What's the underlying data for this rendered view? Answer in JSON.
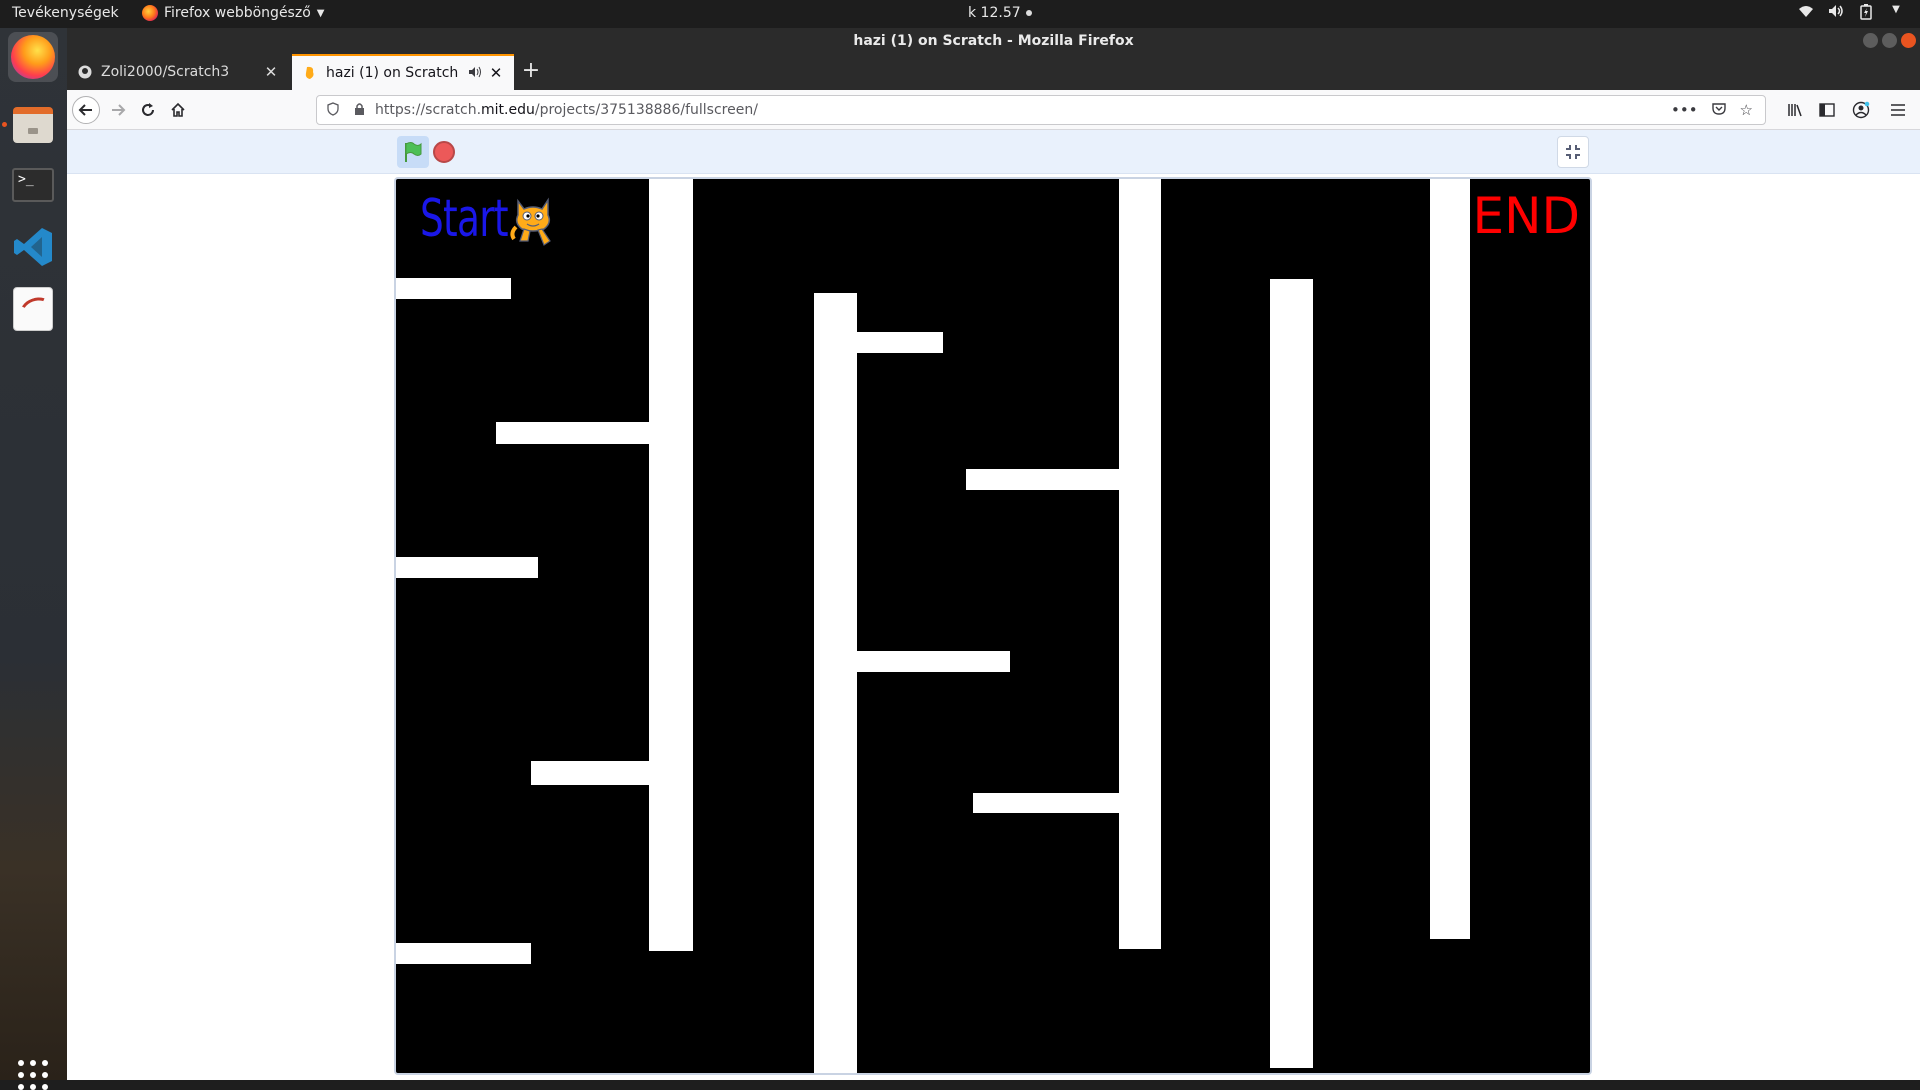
{
  "topbar": {
    "activities": "Tevékenységek",
    "app_menu": "Firefox webböngésző",
    "clock": "k 12.57"
  },
  "window": {
    "title": "hazi (1) on Scratch - Mozilla Firefox"
  },
  "tabs": [
    {
      "title": "Zoli2000/Scratch3",
      "icon": "github-icon"
    },
    {
      "title": "hazi (1) on Scratch",
      "icon": "scratch-icon",
      "active": true,
      "playing_audio": true
    }
  ],
  "navbar": {
    "url_prefix": "https://scratch.",
    "url_domain": "mit.edu",
    "url_path": "/projects/375138886/fullscreen/"
  },
  "stage": {
    "start_label": "Start",
    "end_label": "END",
    "background_color": "#000000",
    "wall_color": "#ffffff",
    "start_color": "#1a17e8",
    "end_color": "#ff0000"
  },
  "colors": {
    "accent_tab": "#ff9400",
    "flag_green": "#4cbf56",
    "stop_red": "#ec5959"
  }
}
